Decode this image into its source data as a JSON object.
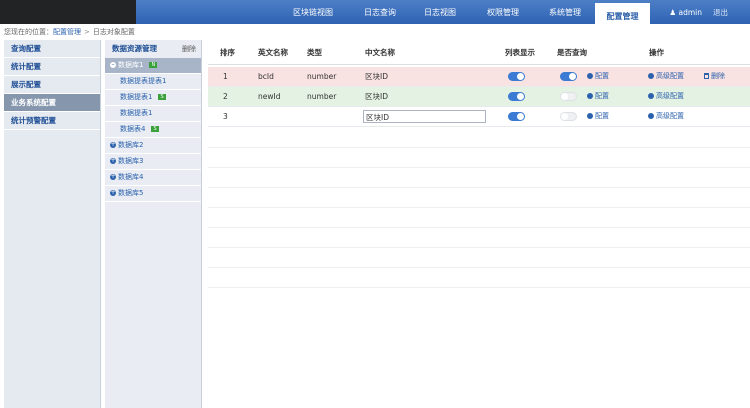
{
  "nav": {
    "items": [
      "区块链视图",
      "日志查询",
      "日志视图",
      "权限管理",
      "系统管理",
      "配置管理"
    ],
    "active_index": 5,
    "user": "admin",
    "logout": "退出"
  },
  "breadcrumb": {
    "prefix": "您现在的位置：",
    "link": "配置管理",
    "separator": ">",
    "current": "日志对象配置"
  },
  "left_menu": {
    "items": [
      "查询配置",
      "统计配置",
      "展示配置",
      "业务系统配置",
      "统计预警配置"
    ],
    "active_index": 3
  },
  "data_source": {
    "title": "数据资源管理",
    "delete_label": "删除",
    "databases": [
      {
        "name": "数据库1",
        "badge": "N",
        "expanded": true,
        "tables": [
          {
            "name": "数据提表提表1",
            "badge": ""
          },
          {
            "name": "数据提表1",
            "badge": "S"
          },
          {
            "name": "数据提表1",
            "badge": ""
          },
          {
            "name": "数据表4",
            "badge": "S"
          }
        ]
      },
      {
        "name": "数据库2",
        "badge": ""
      },
      {
        "name": "数据库3",
        "badge": ""
      },
      {
        "name": "数据库4",
        "badge": ""
      },
      {
        "name": "数据库5",
        "badge": ""
      }
    ]
  },
  "table": {
    "headers": {
      "order": "排序",
      "english_name": "英文名称",
      "type": "类型",
      "chinese_name": "中文名称",
      "list_display": "列表显示",
      "is_query": "是否查询",
      "operation": "操作"
    },
    "rows": [
      {
        "order": "1",
        "english_name": "bcId",
        "type": "number",
        "chinese_name": "区块ID",
        "list_display": true,
        "is_query": true,
        "config": "配置",
        "advanced": "高级配置",
        "delete": "删除",
        "status_color": "#f8e2e2"
      },
      {
        "order": "2",
        "english_name": "newId",
        "type": "number",
        "chinese_name": "区块ID",
        "list_display": true,
        "is_query": false,
        "config": "配置",
        "advanced": "高级配置",
        "delete": "",
        "status_color": "#e4f2e3"
      },
      {
        "order": "3",
        "english_name": "",
        "type": "",
        "chinese_name": "区块ID",
        "list_display": true,
        "is_query": false,
        "config": "配置",
        "advanced": "高级配置",
        "delete": "",
        "status_color": "#ffffff"
      }
    ]
  },
  "colors": {
    "header_blue": "#2f63b3",
    "accent": "#3b7bd4",
    "link": "#2c62ad"
  }
}
